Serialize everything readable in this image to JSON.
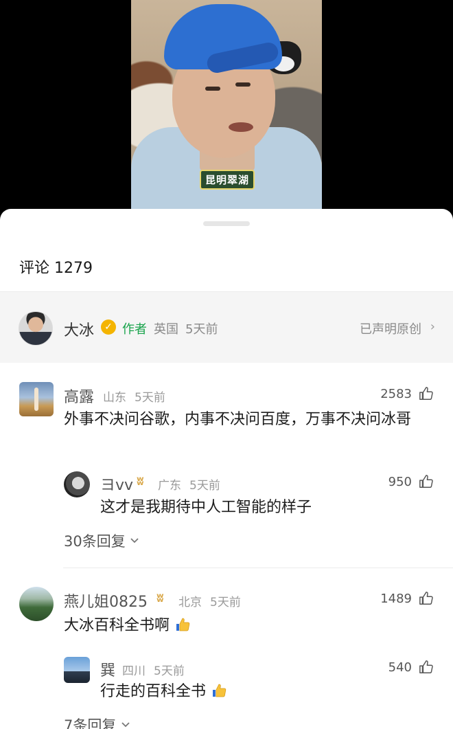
{
  "video": {
    "caption": "昆明翠湖"
  },
  "comments_header": {
    "title": "评论 1279"
  },
  "author_bar": {
    "name": "大冰",
    "verified_mark": "✓",
    "role_tag": "作者",
    "location": "英国",
    "time": "5天前",
    "original_label": "已声明原创",
    "chevron": "›"
  },
  "comments": [
    {
      "user": "高露",
      "location": "山东",
      "time": "5天前",
      "likes": "2583",
      "text": "外事不决问谷歌，内事不决问百度，万事不决问冰哥",
      "replies": [
        {
          "user": "ヨvv",
          "badge": "ʬ",
          "location": "广东",
          "time": "5天前",
          "likes": "950",
          "text": "这才是我期待中人工智能的样子"
        }
      ],
      "more_replies": "30条回复"
    },
    {
      "user": "燕儿姐0825",
      "badge": "ʬ",
      "location": "北京",
      "time": "5天前",
      "likes": "1489",
      "text": "大冰百科全书啊",
      "replies": [
        {
          "user": "巽",
          "location": "四川",
          "time": "5天前",
          "likes": "540",
          "text": "行走的百科全书"
        }
      ],
      "more_replies": "7条回复"
    }
  ],
  "icons": {
    "thumb": "thumbs-up-icon",
    "chevron_down": "chevron-down-icon",
    "chevron_right": "chevron-right-icon"
  },
  "colors": {
    "author_tag": "#17a34a",
    "verified": "#f4b400",
    "vip_badge": "#d9a84a"
  }
}
